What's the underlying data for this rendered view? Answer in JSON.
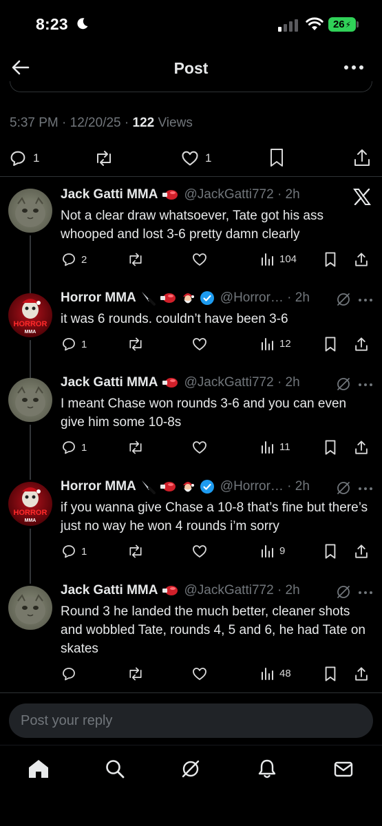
{
  "status_bar": {
    "time": "8:23",
    "battery": "26"
  },
  "nav": {
    "title": "Post"
  },
  "main_post": {
    "timestamp": "5:37 PM · 12/20/25 · ",
    "views_count": "122",
    "views_label": " Views",
    "reply_count": "1",
    "like_count": "1"
  },
  "replies": [
    {
      "name": "Jack Gatti MMA",
      "handle": "@JackGatti772 · 2h",
      "text": "Not a clear draw whatsoever, Tate got his ass whooped and lost 3-6 pretty damn clearly",
      "replies": "2",
      "views": "104"
    },
    {
      "name": "Horror MMA",
      "handle": "@Horror… · 2h",
      "text": "it was 6 rounds. couldn’t have been 3-6",
      "replies": "1",
      "views": "12"
    },
    {
      "name": "Jack Gatti MMA",
      "handle": "@JackGatti772 · 2h",
      "text": "I meant Chase won rounds 3-6 and you can even give him some 10-8s",
      "replies": "1",
      "views": "11"
    },
    {
      "name": "Horror MMA",
      "handle": "@Horror… · 2h",
      "text": "if you wanna give Chase a 10-8 that’s fine but there’s just no way he won 4 rounds i’m sorry",
      "replies": "1",
      "views": "9"
    },
    {
      "name": "Jack Gatti MMA",
      "handle": "@JackGatti772 · 2h",
      "text": "Round 3 he landed the much better, cleaner shots and wobbled Tate, rounds 4, 5 and 6, he had Tate on skates",
      "replies": "",
      "views": "48"
    }
  ],
  "avatar_text": {
    "horror_logo": "HORROR",
    "horror_sub": "MMA"
  },
  "reply_box": {
    "placeholder": "Post your reply"
  },
  "icons": {
    "bottom_nav": [
      "home-icon",
      "search-icon",
      "grok-icon",
      "bell-icon",
      "mail-icon"
    ]
  },
  "colors": {
    "background": "#000000",
    "text_primary": "#e7e9ea",
    "text_secondary": "#71767b",
    "verified": "#1d9bf0",
    "battery": "#30d158",
    "reply_box": "#202327"
  }
}
